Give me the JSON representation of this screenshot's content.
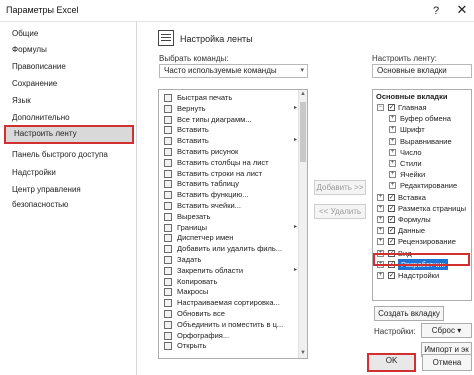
{
  "window": {
    "title": "Параметры Excel",
    "help_glyph": "?",
    "close_glyph": "✕"
  },
  "sidebar": {
    "items": [
      {
        "label": "Общие"
      },
      {
        "label": "Формулы"
      },
      {
        "label": "Правописание"
      },
      {
        "label": "Сохранение"
      },
      {
        "label": "Язык"
      },
      {
        "label": "Дополнительно"
      },
      {
        "label": "Настроить ленту",
        "selected": true
      },
      {
        "label": "Панель быстрого доступа"
      },
      {
        "label": "Надстройки"
      },
      {
        "label": "Центр управления безопасностью"
      }
    ]
  },
  "main": {
    "header": {
      "title": "Настройка ленты",
      "icon": "ribbon-customize-icon"
    },
    "choose_commands": {
      "label": "Выбрать команды:",
      "value": "Часто используемые команды"
    },
    "customize_ribbon": {
      "label": "Настроить ленту:",
      "value": "Основные вкладки"
    },
    "commands": [
      {
        "label": "Быстрая печать",
        "icon": "quick-print-icon"
      },
      {
        "label": "Вернуть",
        "icon": "redo-icon",
        "submenu": true
      },
      {
        "label": "Все типы диаграмм...",
        "icon": "all-charts-icon"
      },
      {
        "label": "Вставить",
        "icon": "paste-icon"
      },
      {
        "label": "Вставить",
        "icon": "paste-special-icon",
        "submenu": true
      },
      {
        "label": "Вставить рисунок",
        "icon": "insert-picture-icon"
      },
      {
        "label": "Вставить столбцы на лист",
        "icon": "insert-columns-icon"
      },
      {
        "label": "Вставить строки на лист",
        "icon": "insert-rows-icon"
      },
      {
        "label": "Вставить таблицу",
        "icon": "insert-table-icon"
      },
      {
        "label": "Вставить функцию...",
        "icon": "insert-function-icon"
      },
      {
        "label": "Вставить ячейки...",
        "icon": "insert-cells-icon"
      },
      {
        "label": "Вырезать",
        "icon": "cut-icon"
      },
      {
        "label": "Границы",
        "icon": "borders-icon",
        "submenu": true
      },
      {
        "label": "Диспетчер имен",
        "icon": "name-manager-icon"
      },
      {
        "label": "Добавить или удалить филь...",
        "icon": "filter-icon"
      },
      {
        "label": "Задать",
        "icon": "set-icon"
      },
      {
        "label": "Закрепить области",
        "icon": "freeze-panes-icon",
        "submenu": true
      },
      {
        "label": "Копировать",
        "icon": "copy-icon"
      },
      {
        "label": "Макросы",
        "icon": "macros-icon"
      },
      {
        "label": "Настраиваемая сортировка...",
        "icon": "custom-sort-icon"
      },
      {
        "label": "Обновить все",
        "icon": "refresh-all-icon"
      },
      {
        "label": "Объединить и поместить в ц...",
        "icon": "merge-center-icon"
      },
      {
        "label": "Орфография...",
        "icon": "spelling-icon"
      },
      {
        "label": "Открыть",
        "icon": "open-icon"
      }
    ],
    "add_button": "Добавить >>",
    "remove_button": "<< Удалить",
    "tree": {
      "header": "Основные вкладки",
      "rows": [
        {
          "label": "Главная",
          "level": 0,
          "expander": "⊟",
          "checked": true
        },
        {
          "label": "Буфер обмена",
          "level": 1,
          "expander": "⊞"
        },
        {
          "label": "Шрифт",
          "level": 1,
          "expander": "⊞"
        },
        {
          "label": "Выравнивание",
          "level": 1,
          "expander": "⊞"
        },
        {
          "label": "Число",
          "level": 1,
          "expander": "⊞"
        },
        {
          "label": "Стили",
          "level": 1,
          "expander": "⊞"
        },
        {
          "label": "Ячейки",
          "level": 1,
          "expander": "⊞"
        },
        {
          "label": "Редактирование",
          "level": 1,
          "expander": "⊞"
        },
        {
          "label": "Вставка",
          "level": 0,
          "expander": "⊞",
          "checked": true
        },
        {
          "label": "Разметка страницы",
          "level": 0,
          "expander": "⊞",
          "checked": true
        },
        {
          "label": "Формулы",
          "level": 0,
          "expander": "⊞",
          "checked": true
        },
        {
          "label": "Данные",
          "level": 0,
          "expander": "⊞",
          "checked": true
        },
        {
          "label": "Рецензирование",
          "level": 0,
          "expander": "⊞",
          "checked": true
        },
        {
          "label": "Вид",
          "level": 0,
          "expander": "⊞",
          "checked": true
        },
        {
          "label": "Разработчик",
          "level": 0,
          "expander": "⊞",
          "checked": true,
          "selected": true
        },
        {
          "label": "Надстройки",
          "level": 0,
          "expander": "⊞",
          "checked": true
        }
      ]
    },
    "create_tab_button": "Создать вкладку",
    "settings_label": "Настройки:",
    "reset_button": "Сброс ▾",
    "import_export_button": "Импорт и эк"
  },
  "footer": {
    "ok_button": "OK",
    "cancel_button": "Отмена"
  },
  "check_glyph": "✓",
  "submenu_glyph": "▸",
  "combo_arrow": "▾"
}
